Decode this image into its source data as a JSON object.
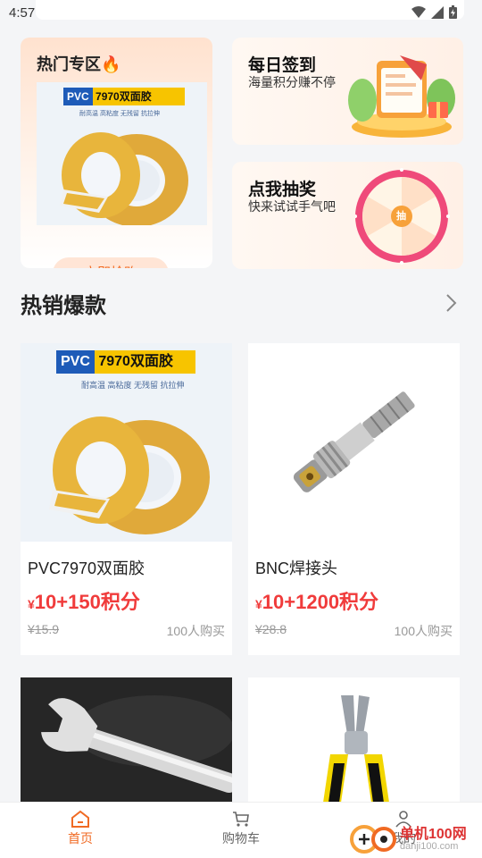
{
  "status": {
    "time": "4:57"
  },
  "promo_hot": {
    "title": "热门专区🔥",
    "button": "立即抢购",
    "image_banner": "7970双面胶",
    "image_banner_prefix": "PVC",
    "image_sub": "耐高温 高粘度 无残留 抗拉伸"
  },
  "promo_checkin": {
    "title": "每日签到",
    "subtitle": "海量积分赚不停"
  },
  "promo_lottery": {
    "title": "点我抽奖",
    "subtitle": "快来试试手气吧",
    "wheel_center": "抽"
  },
  "section": {
    "title": "热销爆款"
  },
  "products": [
    {
      "name": "PVC7970双面胶",
      "yen": "¥",
      "price": "10+150积分",
      "original": "¥15.9",
      "sold": "100人购买",
      "banner_prefix": "PVC",
      "banner": "7970双面胶",
      "banner_sub": "耐高温 高粘度 无残留 抗拉伸"
    },
    {
      "name": "BNC焊接头",
      "yen": "¥",
      "price": "10+1200积分",
      "original": "¥28.8",
      "sold": "100人购买"
    },
    {
      "name": "",
      "yen": "",
      "price": "",
      "original": "",
      "sold": ""
    },
    {
      "name": "",
      "yen": "",
      "price": "",
      "original": "",
      "sold": ""
    }
  ],
  "tabbar": {
    "home": "首页",
    "cart": "购物车",
    "mine": "我的"
  },
  "watermark": {
    "text": "单机100网",
    "url": "danji100.com"
  },
  "colors": {
    "accent": "#f06a23",
    "price": "#f03b3b",
    "tape": "#e8b53c"
  }
}
